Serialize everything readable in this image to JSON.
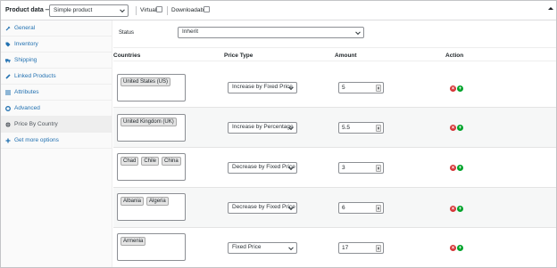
{
  "header": {
    "title": "Product data —",
    "product_type": "Simple product",
    "virtual_label": "Virtual:",
    "downloadable_label": "Downloadable:"
  },
  "sidebar": {
    "items": [
      {
        "label": "General",
        "icon": "wrench-icon"
      },
      {
        "label": "Inventory",
        "icon": "tag-icon"
      },
      {
        "label": "Shipping",
        "icon": "truck-icon"
      },
      {
        "label": "Linked Products",
        "icon": "link-icon"
      },
      {
        "label": "Attributes",
        "icon": "list-icon"
      },
      {
        "label": "Advanced",
        "icon": "gear-icon"
      },
      {
        "label": "Price By Country",
        "icon": "globe-icon",
        "active": true
      },
      {
        "label": "Get more options",
        "icon": "plus-icon"
      }
    ]
  },
  "main": {
    "status_label": "Status",
    "status_value": "Inherit",
    "columns": [
      "Countries",
      "Price Type",
      "Amount",
      "Action"
    ],
    "rows": [
      {
        "countries": [
          "United States (US)"
        ],
        "price_type": "Increase by Fixed Price",
        "amount": "5"
      },
      {
        "countries": [
          "United Kingdom (UK)"
        ],
        "price_type": "Increase by Percentage",
        "amount": "5.5"
      },
      {
        "countries": [
          "Chad",
          "Chile",
          "China"
        ],
        "price_type": "Decrease by Fixed Price",
        "amount": "3"
      },
      {
        "countries": [
          "Albania",
          "Algeria"
        ],
        "price_type": "Decrease by Fixed Price",
        "amount": "6"
      },
      {
        "countries": [
          "Armenia"
        ],
        "price_type": "Fixed Price",
        "amount": "17"
      }
    ]
  },
  "colors": {
    "link": "#2271b1",
    "delete": "#d63638",
    "add": "#00a32a"
  }
}
